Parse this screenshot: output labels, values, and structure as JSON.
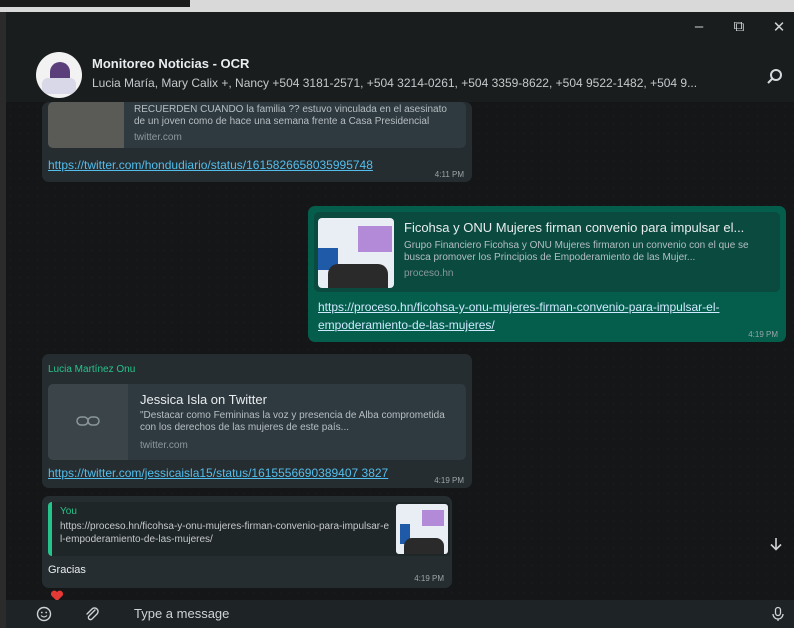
{
  "window": {
    "minimize": "–",
    "restore": "⧉",
    "close": "✕"
  },
  "header": {
    "title": "Monitoreo Noticias - OCR",
    "subtitle": "Lucia  María, Mary Calix +, Nancy  +504 3181-2571, +504 3214-0261, +504 3359-8622, +504 9522-1482, +504 9..."
  },
  "messages": {
    "m1": {
      "desc": "RECUERDEN CUÁNDO la familia ?? estuvo vinculada en el asesinato de un joven como de hace una semana frente a Casa Presidencial",
      "domain": "twitter.com",
      "url": "https://twitter.com/hondudiario/status/1615826658035995748",
      "time": "4:11 PM"
    },
    "m2": {
      "title": "Ficohsa y ONU Mujeres firman convenio para impulsar el...",
      "desc": "Grupo Financiero Ficohsa y ONU Mujeres firmaron un convenio con el que se busca promover los Principios de Empoderamiento de las Mujer...",
      "domain": "proceso.hn",
      "url1": "https://proceso.hn/ficohsa-y-onu-mujeres-firman-convenio-para-impulsar-el-",
      "url2": "empoderamiento-de-las-mujeres/",
      "time": "4:19 PM"
    },
    "m3": {
      "sender": "Lucia Martínez Onu",
      "title": "Jessica Isla on Twitter",
      "desc": "\"Destacar como Femininas la voz y presencia de Alba comprometida con los derechos de las mujeres de este país...",
      "domain": "twitter.com",
      "url": "https://twitter.com/jessicaisla15/status/1615556690389407 3827",
      "time": "4:19 PM"
    },
    "m4": {
      "quote_author": "You",
      "quote_text": "https://proceso.hn/ficohsa-y-onu-mujeres-firman-convenio-para-impulsar-el-empoderamiento-de-las-mujeres/",
      "text": "Gracias",
      "time": "4:19 PM"
    }
  },
  "footer": {
    "placeholder": "Type a message"
  },
  "colors": {
    "incoming": "#262d31",
    "outgoing": "#055d4c",
    "sender": "#25c48a",
    "link": "#53bdeb"
  }
}
